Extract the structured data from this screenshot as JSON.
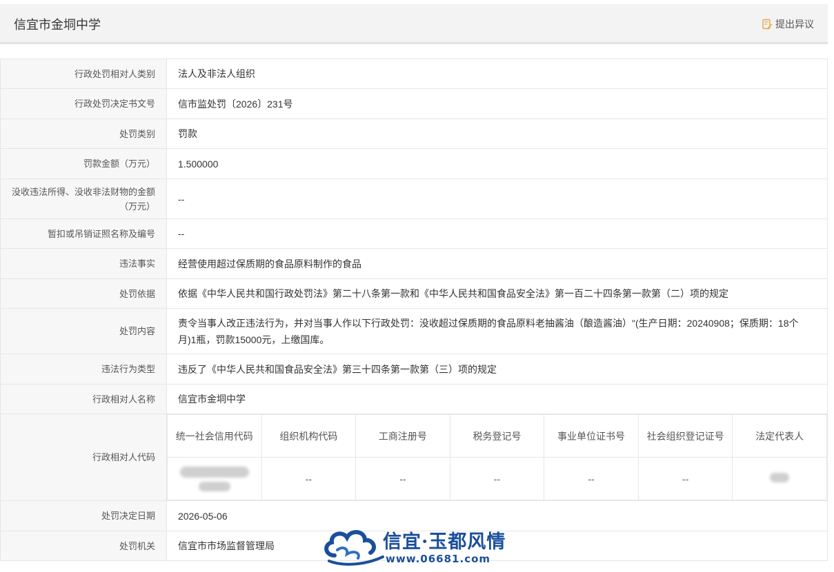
{
  "header": {
    "title": "信宜市金垌中学",
    "objection_label": "提出异议",
    "objection_icon": "edit-note-icon"
  },
  "rows": {
    "party_category": {
      "label": "行政处罚相对人类别",
      "value": "法人及非法人组织"
    },
    "decision_no": {
      "label": "行政处罚决定书文号",
      "value": "信市监处罚〔2026〕231号"
    },
    "penalty_type": {
      "label": "处罚类别",
      "value": "罚款"
    },
    "fine_amount": {
      "label": "罚款金额（万元）",
      "value": "1.500000"
    },
    "confiscation": {
      "label": "没收违法所得、没收非法财物的金额（万元）",
      "value": "--"
    },
    "license_suspension": {
      "label": "暂扣或吊销证照名称及编号",
      "value": "--"
    },
    "illegal_facts": {
      "label": "违法事实",
      "value": "经营使用超过保质期的食品原料制作的食品"
    },
    "penalty_basis": {
      "label": "处罚依据",
      "value": "依据《中华人民共和国行政处罚法》第二十八条第一款和《中华人民共和国食品安全法》第一百二十四条第一款第（二）项的规定"
    },
    "penalty_content": {
      "label": "处罚内容",
      "value": "责令当事人改正违法行为，并对当事人作以下行政处罚：没收超过保质期的食品原料老抽酱油（酿造酱油）\"(生产日期：20240908；保质期：18个月)1瓶，罚款15000元，上缴国库。"
    },
    "violation_type": {
      "label": "违法行为类型",
      "value": "违反了《中华人民共和国食品安全法》第三十四条第一款第（三）项的规定"
    },
    "party_name": {
      "label": "行政相对人名称",
      "value": "信宜市金垌中学"
    },
    "party_code": {
      "label": "行政相对人代码",
      "columns": [
        "统一社会信用代码",
        "组织机构代码",
        "工商注册号",
        "税务登记号",
        "事业单位证书号",
        "社会组织登记证号",
        "法定代表人"
      ],
      "values": [
        "",
        "--",
        "--",
        "--",
        "--",
        "--",
        ""
      ]
    },
    "decision_date": {
      "label": "处罚决定日期",
      "value": "2026-05-06"
    },
    "authority": {
      "label": "处罚机关",
      "value": "信宜市市场监督管理局"
    }
  },
  "watermark": {
    "text": "信宜·玉都风情",
    "url": "www.06681.com",
    "color": "#1b4f9c"
  }
}
